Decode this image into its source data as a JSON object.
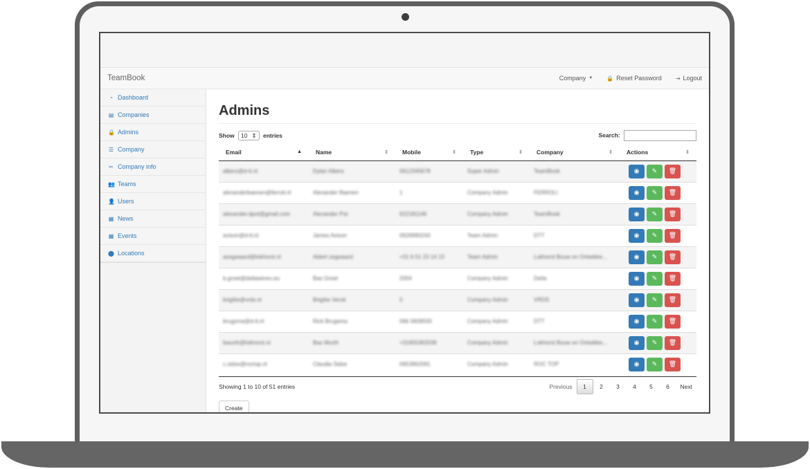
{
  "app": {
    "brand": "TeamBook"
  },
  "navbar": {
    "company_label": "Company",
    "reset_password_label": "Reset Password",
    "logout_label": "Logout"
  },
  "sidebar": {
    "items": [
      {
        "label": "Dashboard",
        "icon": "dashboard-icon",
        "glyph": "◔"
      },
      {
        "label": "Companies",
        "icon": "building-icon",
        "glyph": "▤"
      },
      {
        "label": "Admins",
        "icon": "lock-icon",
        "glyph": "🔒"
      },
      {
        "label": "Company",
        "icon": "sliders-icon",
        "glyph": "☰"
      },
      {
        "label": "Company info",
        "icon": "scissors-icon",
        "glyph": "✂"
      },
      {
        "label": "Teams",
        "icon": "users-icon",
        "glyph": "👥"
      },
      {
        "label": "Users",
        "icon": "user-icon",
        "glyph": "👤"
      },
      {
        "label": "News",
        "icon": "file-icon",
        "glyph": "▦"
      },
      {
        "label": "Events",
        "icon": "calendar-icon",
        "glyph": "▦"
      },
      {
        "label": "Locations",
        "icon": "map-marker-icon",
        "glyph": "⬤"
      }
    ]
  },
  "main": {
    "title": "Admins",
    "show_label": "Show",
    "entries_label": "entries",
    "page_size": "10",
    "search_label": "Search:",
    "columns": [
      "Email",
      "Name",
      "Mobile",
      "Type",
      "Company",
      "Actions"
    ],
    "rows": [
      {
        "email": "albers@d-tt.nl",
        "name": "Dylan Albers",
        "mobile": "0612345678",
        "type": "Super Admin",
        "company": "TeamBook"
      },
      {
        "email": "alexanderbaenen@ferroli.nl",
        "name": "Alexander Baenen",
        "mobile": "1",
        "type": "Company Admin",
        "company": "FERROLI"
      },
      {
        "email": "alexander.dpot@gmail.com",
        "name": "Alexander Pot",
        "mobile": "622181146",
        "type": "Company Admin",
        "company": "TeamBook"
      },
      {
        "email": "avison@d-tt.nl",
        "name": "James Avison",
        "mobile": "0626990243",
        "type": "Team Admin",
        "company": "DTT"
      },
      {
        "email": "azegwaard@lokhorst.nl",
        "name": "Aldert zegwaard",
        "mobile": "+31 6 51 23 14 13",
        "type": "Team Admin",
        "company": "Lokhorst Bouw en Ontwikke..."
      },
      {
        "email": "b.groet@deltawinex.eu",
        "name": "Bas Groet",
        "mobile": "2004",
        "type": "Company Admin",
        "company": "Delta"
      },
      {
        "email": "brigitte@vrds.nl",
        "name": "Brigitte Verok",
        "mobile": "0",
        "type": "Company Admin",
        "company": "VRDS"
      },
      {
        "email": "brugsma@d-tt.nl",
        "name": "Rick Brugsma",
        "mobile": "066 0609500",
        "type": "Company Admin",
        "company": "DTT"
      },
      {
        "email": "bwurth@lokhorst.nl",
        "name": "Bas Wurth",
        "mobile": "+31655362039",
        "type": "Company Admin",
        "company": "Lokhorst Bouw en Ontwikke..."
      },
      {
        "email": "c.sidse@roctop.nl",
        "name": "Claudia Sidse",
        "mobile": "0653962091",
        "type": "Company Admin",
        "company": "ROC TOP"
      }
    ],
    "info": "Showing 1 to 10 of 51 entries",
    "pagination": {
      "previous": "Previous",
      "pages": [
        "1",
        "2",
        "3",
        "4",
        "5",
        "6"
      ],
      "current": "1",
      "next": "Next"
    },
    "create_label": "Create"
  },
  "colors": {
    "view": "#337ab7",
    "edit": "#5cb85c",
    "delete": "#d9534f",
    "link": "#337ab7"
  }
}
